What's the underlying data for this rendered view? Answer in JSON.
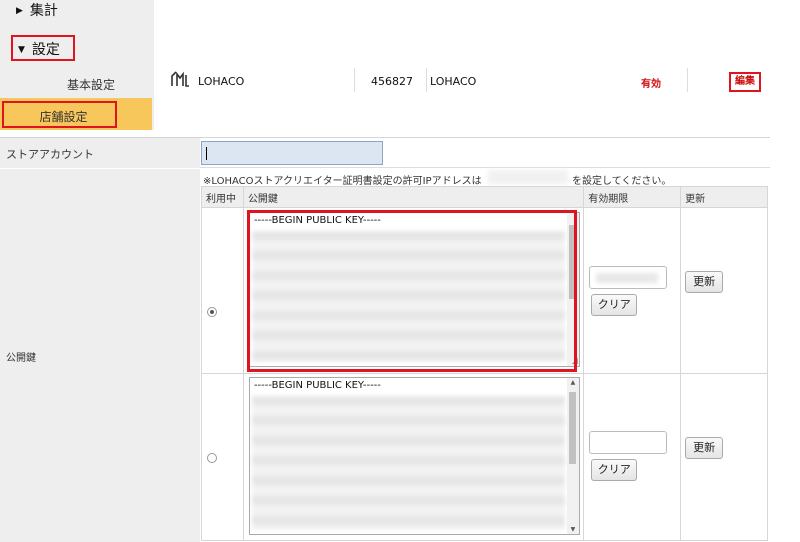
{
  "sidebar": {
    "summary_label": "集計",
    "settings_label": "設定",
    "basic_label": "基本設定",
    "store_label": "店舗設定"
  },
  "store": {
    "logo_text": "LOHACO",
    "id": "456827",
    "name": "LOHACO",
    "status": "有効",
    "edit_label": "編集"
  },
  "form": {
    "account_label": "ストアアカウント",
    "account_value": "",
    "key_label": "公開鍵",
    "notice_text": "※LOHACOストアクリエイター証明書設定の許可IPアドレスは",
    "notice_tail": "を設定してください。",
    "columns": [
      "利用中",
      "公開鍵",
      "有効期限",
      "更新"
    ],
    "keys": [
      {
        "in_use": true,
        "header": "-----BEGIN PUBLIC KEY-----",
        "clear_label": "クリア",
        "update_label": "更新"
      },
      {
        "in_use": false,
        "header": "-----BEGIN PUBLIC KEY-----",
        "clear_label": "クリア",
        "update_label": "更新"
      }
    ]
  },
  "colors": {
    "highlight": "#e0141e",
    "selected_nav": "#f7c75b",
    "status_red": "#d01010"
  }
}
